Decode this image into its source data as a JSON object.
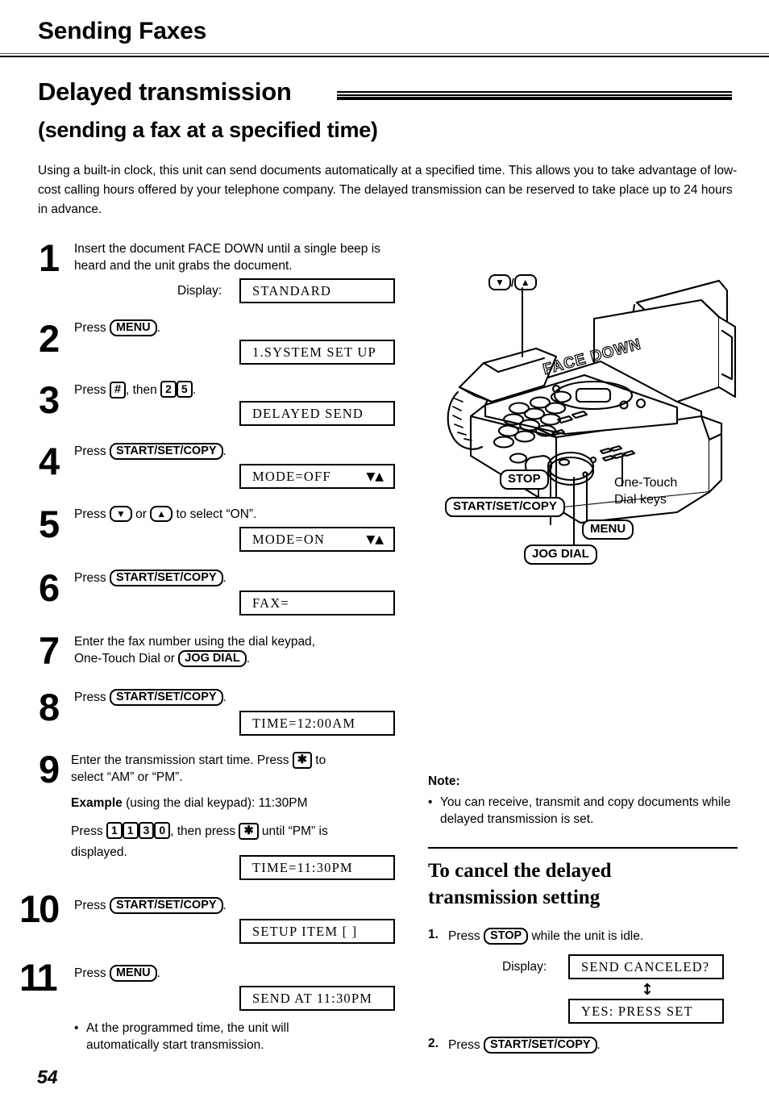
{
  "header": {
    "running_head": "Sending Faxes"
  },
  "titles": {
    "main": "Delayed transmission",
    "sub": "(sending a fax at a specified time)"
  },
  "intro": "Using a built-in clock, this unit can send documents automatically at a specified time. This allows you to take advantage of low-cost calling hours offered by your telephone company. The delayed transmission can be reserved to take place up to 24 hours in advance.",
  "labels": {
    "display": "Display:",
    "press": "Press",
    "then": ", then",
    "or": "or"
  },
  "steps": [
    {
      "num": "1",
      "text": "Insert the document FACE DOWN until a single beep is heard and the unit grabs the document.",
      "display_label": "Display:",
      "lcd": "STANDARD"
    },
    {
      "num": "2",
      "key": "MENU",
      "lcd": "1.SYSTEM SET UP"
    },
    {
      "num": "3",
      "key": "#",
      "keys": [
        "2",
        "5"
      ],
      "lcd": "DELAYED SEND"
    },
    {
      "num": "4",
      "key": "START/SET/COPY",
      "lcd": "MODE=OFF",
      "lcd_arrows": "▼▲"
    },
    {
      "num": "5",
      "text_tail": "to select “ON”.",
      "lcd": "MODE=ON",
      "lcd_arrows": "▼▲"
    },
    {
      "num": "6",
      "key": "START/SET/COPY",
      "lcd": "FAX="
    },
    {
      "num": "7",
      "text_a": "Enter the fax number using the dial keypad,",
      "text_b": "One-Touch Dial or",
      "key": "JOG DIAL"
    },
    {
      "num": "8",
      "key": "START/SET/COPY",
      "lcd": "TIME=12:00AM"
    },
    {
      "num": "9",
      "text_a": "Enter the transmission start time. Press",
      "text_a2": "to",
      "text_b": "select “AM” or “PM”.",
      "example_bold": "Example",
      "example_rest": "(using the dial keypad):  11:30PM",
      "press_word": "Press",
      "digits": [
        "1",
        "1",
        "3",
        "0"
      ],
      "then_press": ", then press",
      "until": "until “PM” is",
      "displayed": "displayed.",
      "star": "✱",
      "lcd": "TIME=11:30PM"
    },
    {
      "num": "10",
      "key": "START/SET/COPY",
      "lcd": "SETUP ITEM [  ]"
    },
    {
      "num": "11",
      "key": "MENU",
      "lcd": "SEND AT 11:30PM",
      "bullet": "At the programmed time, the unit will automatically start transmission."
    }
  ],
  "illustration": {
    "face_down_label": "FACE DOWN",
    "updown_keys": {
      "down": "▼",
      "slash": "/",
      "up": "▲"
    },
    "callouts": [
      {
        "name": "stop",
        "label": "STOP"
      },
      {
        "name": "start-set-copy",
        "label": "START/SET/COPY"
      },
      {
        "name": "menu",
        "label": "MENU"
      },
      {
        "name": "jog-dial",
        "label": "JOG DIAL"
      }
    ],
    "plain_label": {
      "line1": "One-Touch",
      "line2": "Dial keys"
    }
  },
  "note": {
    "heading": "Note:",
    "bullet": "You can receive, transmit and copy documents while delayed transmission is set."
  },
  "cancel": {
    "title_l1": "To cancel the delayed",
    "title_l2": "transmission setting",
    "step1_num": "1.",
    "step1_press": "Press",
    "step1_key": "STOP",
    "step1_tail": "while the unit is idle.",
    "display_label": "Display:",
    "lcd1": "SEND CANCELED?",
    "swap": "↕",
    "lcd2": "YES: PRESS SET",
    "step2_num": "2.",
    "step2_press": "Press",
    "step2_key": "START/SET/COPY",
    "step2_tail": "."
  },
  "page_number": "54"
}
